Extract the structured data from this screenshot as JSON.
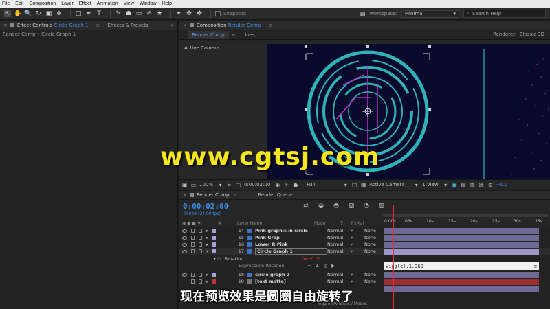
{
  "menu": [
    "File",
    "Edit",
    "Composition",
    "Layer",
    "Effect",
    "Animation",
    "View",
    "Window",
    "Help"
  ],
  "toolbar": {
    "snapping": "Snapping",
    "workspace_label": "Workspace:",
    "workspace_value": "Minimal",
    "search_help": "Search Help"
  },
  "left_panel": {
    "tab_effect_controls": "Effect Controls",
    "tab_effect_controls_target": "Circle Graph 1",
    "tab_effects_presets": "Effects & Presets",
    "breadcrumb": "Render Comp • Circle Graph 1"
  },
  "comp_panel": {
    "tab_label": "Composition",
    "tab_target": "Render Comp",
    "subtab_render": "Render Comp",
    "subtab_lines": "Lines",
    "renderer_label": "Renderer:",
    "renderer_value": "Classic 3D",
    "active_camera": "Active Camera",
    "zoom": "100%",
    "timecode": "0:00:02:00",
    "resolution": "Full",
    "camera": "Active Camera",
    "views": "1 View",
    "exposure": "+0.0"
  },
  "timeline": {
    "tab_render_comp": "Render Comp",
    "tab_render_queue": "Render Queue",
    "timecode": "0:00:02:00",
    "frames": "00048 (24.00 fps)",
    "columns": {
      "hash": "#",
      "layer_name": "Layer Name",
      "mode": "Mode",
      "t": "T",
      "trkmat": "TrkMat"
    },
    "ruler": [
      "0:00s",
      "05s",
      "10s",
      "15s",
      "20s",
      "25s",
      "30s",
      "35s"
    ],
    "layers": [
      {
        "num": "14",
        "name": "Pink graphic in circle",
        "mode": "Normal",
        "trkmat": "None",
        "color": "#a7a0d6"
      },
      {
        "num": "15",
        "name": "Pink Grap",
        "mode": "Normal",
        "trkmat": "None",
        "color": "#a7a0d6"
      },
      {
        "num": "16",
        "name": "Lower R Pink",
        "mode": "Normal",
        "trkmat": "None",
        "color": "#a7a0d6"
      },
      {
        "num": "17",
        "name": "Circle Graph 1",
        "mode": "Normal",
        "trkmat": "None",
        "color": "#a7a0d6"
      }
    ],
    "prop_rotation": "Rotation",
    "prop_rotation_value": "0x+0.0°",
    "expression_label": "Expression: Rotation",
    "expression_text": "wiggle(.1,360",
    "layers_lower": [
      {
        "num": "18",
        "name": "circle graph 2",
        "mode": "Normal",
        "trkmat": "None",
        "color": "#a7a0d6"
      },
      {
        "num": "19",
        "name": "[text matte]",
        "mode": "Normal",
        "trkmat": "None",
        "color": "#c2343b"
      }
    ],
    "toggle_label": "Toggle Switches / Modes"
  },
  "overlay": {
    "subtitle": "现在预览效果是圆圈自由旋转了",
    "watermark": "www.cgtsj.com"
  },
  "colors": {
    "accent_blue": "#3a8ee6",
    "canvas_bg": "#0a0a2c",
    "ring_cyan": "#2fb3b8",
    "magenta": "#b52fd0",
    "playhead": "#e8303a"
  }
}
